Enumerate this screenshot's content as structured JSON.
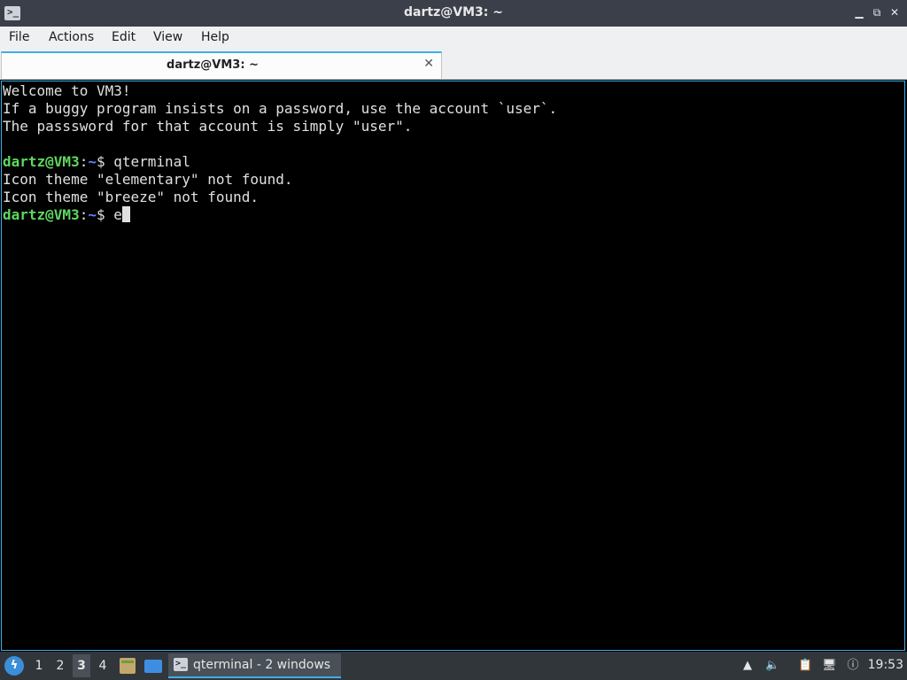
{
  "window": {
    "title": "dartz@VM3: ~",
    "app_icon_glyph": ">_",
    "minimize_glyph": "▁",
    "restore_glyph": "⧉",
    "close_glyph": "✕"
  },
  "menu": {
    "file": "File",
    "actions": "Actions",
    "edit": "Edit",
    "view": "View",
    "help": "Help"
  },
  "tab": {
    "label": "dartz@VM3: ~",
    "close_glyph": "✕"
  },
  "terminal": {
    "line1": "Welcome to VM3!",
    "line2": "If a buggy program insists on a password, use the account `user`.",
    "line3": "The passsword for that account is simply \"user\".",
    "prompt_user_host": "dartz@VM3",
    "prompt_sep": ":",
    "prompt_path": "~",
    "prompt_symbol": "$ ",
    "command1": "qterminal",
    "line6": "Icon theme \"elementary\" not found.",
    "line7": "Icon theme \"breeze\" not found.",
    "current_input": "e"
  },
  "taskbar": {
    "start_glyph": "ϟ",
    "desktops": [
      "1",
      "2",
      "3",
      "4"
    ],
    "active_desktop": "3",
    "task_label": "qterminal - 2 windows",
    "task_icon_glyph": ">_",
    "clock": "19:53",
    "accent_color": "#3daee9"
  }
}
